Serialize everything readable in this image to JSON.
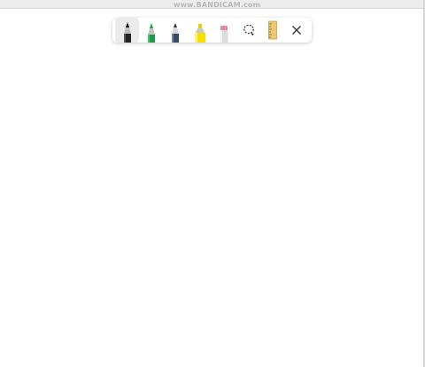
{
  "watermark": {
    "text": "www.BANDICAM.com"
  },
  "toolbar": {
    "tools": [
      {
        "icon": "ballpoint-pen-icon",
        "color": "#111111",
        "selected": true
      },
      {
        "icon": "pen-icon",
        "color": "#1f9a4a",
        "selected": false
      },
      {
        "icon": "pencil-icon",
        "color": "#3a4a60",
        "selected": false
      },
      {
        "icon": "highlighter-icon",
        "color": "#f5e000",
        "selected": false
      },
      {
        "icon": "eraser-icon",
        "color": "#e08aa0",
        "selected": false
      },
      {
        "icon": "lasso-select-icon",
        "color": "#333333",
        "selected": false
      },
      {
        "icon": "ruler-icon",
        "color": "#e8c873",
        "selected": false
      },
      {
        "icon": "close-icon",
        "color": "#333333",
        "selected": false
      }
    ]
  }
}
